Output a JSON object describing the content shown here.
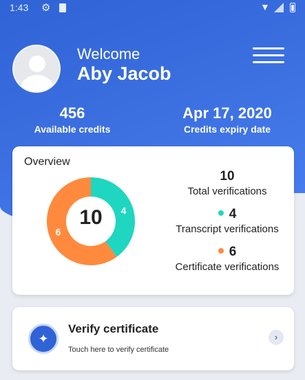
{
  "status_bar": {
    "time": "1:43",
    "icons": [
      "gear-icon",
      "sd-card-icon",
      "wifi-icon",
      "signal-icon",
      "battery-icon"
    ]
  },
  "header": {
    "welcome": "Welcome",
    "user_name": "Aby Jacob",
    "menu_icon": "hamburger-menu-icon"
  },
  "stats": {
    "credits_value": "456",
    "credits_label": "Available credits",
    "expiry_value": "Apr 17, 2020",
    "expiry_label": "Credits expiry date"
  },
  "overview": {
    "title": "Overview",
    "total_value": "10",
    "total_label": "Total verifications",
    "transcript_value": "4",
    "transcript_label": "Transcript verifications",
    "certificate_value": "6",
    "certificate_label": "Certificate verifications",
    "donut_center": "10",
    "transcript_count": 4,
    "certificate_count": 6,
    "colors": {
      "transcript": "#1fd6c0",
      "certificate": "#ff8a3d",
      "brand": "#2f63d6"
    }
  },
  "verify": {
    "title": "Verify certificate",
    "subtitle": "Touch here to verify certificate",
    "icon": "stamp-icon",
    "action_icon": "chevron-right-icon"
  }
}
